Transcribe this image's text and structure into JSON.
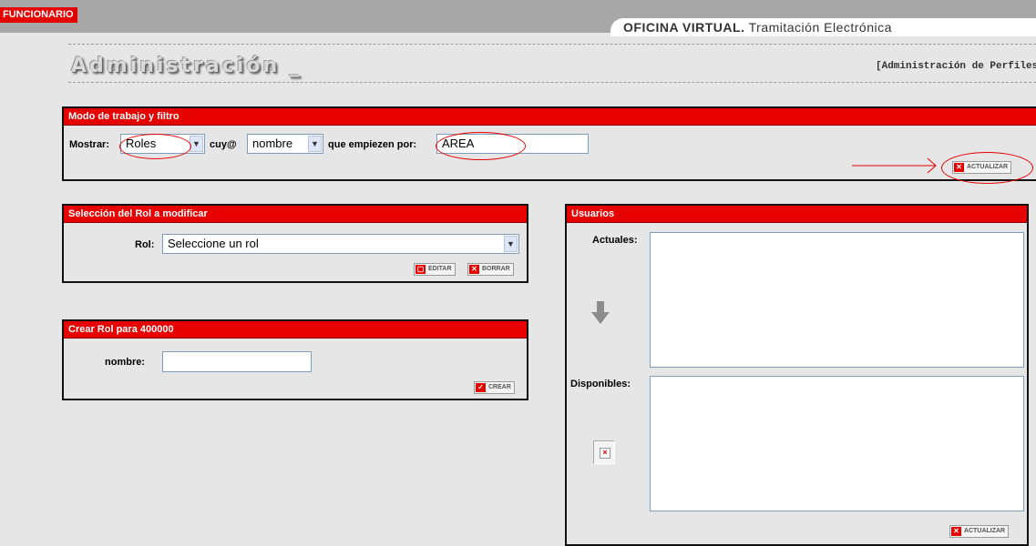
{
  "header": {
    "role_badge": "FUNCIONARIO",
    "office_strong": "OFICINA VIRTUAL.",
    "office_rest": " Tramitación Electrónica",
    "page_title": "Administración _",
    "admin_link": "[Administración de Perfiles]"
  },
  "filter_panel": {
    "title": "Modo de trabajo y filtro",
    "show_label": "Mostrar:",
    "show_value": "Roles",
    "cuy_label": "cuy@",
    "field_value": "nombre",
    "starts_label": "que empiezen por:",
    "starts_value": "AREA",
    "update_button": "ACTUALIZAR"
  },
  "select_panel": {
    "title": "Selección del Rol a modificar",
    "rol_label": "Rol:",
    "rol_value": "Seleccione un rol",
    "edit_button": "EDITAR",
    "delete_button": "BORRAR"
  },
  "create_panel": {
    "title": "Crear Rol para 400000",
    "name_label": "nombre:",
    "name_value": "",
    "create_button": "CREAR"
  },
  "users_panel": {
    "title": "Usuarios",
    "current_label": "Actuales:",
    "available_label": "Disponibles:",
    "move_icon": "arrow-down-icon",
    "update_button": "ACTUALIZAR"
  },
  "colors": {
    "accent": "#e60000",
    "background": "#e6e6e6",
    "topbar": "#a7a7a7"
  }
}
